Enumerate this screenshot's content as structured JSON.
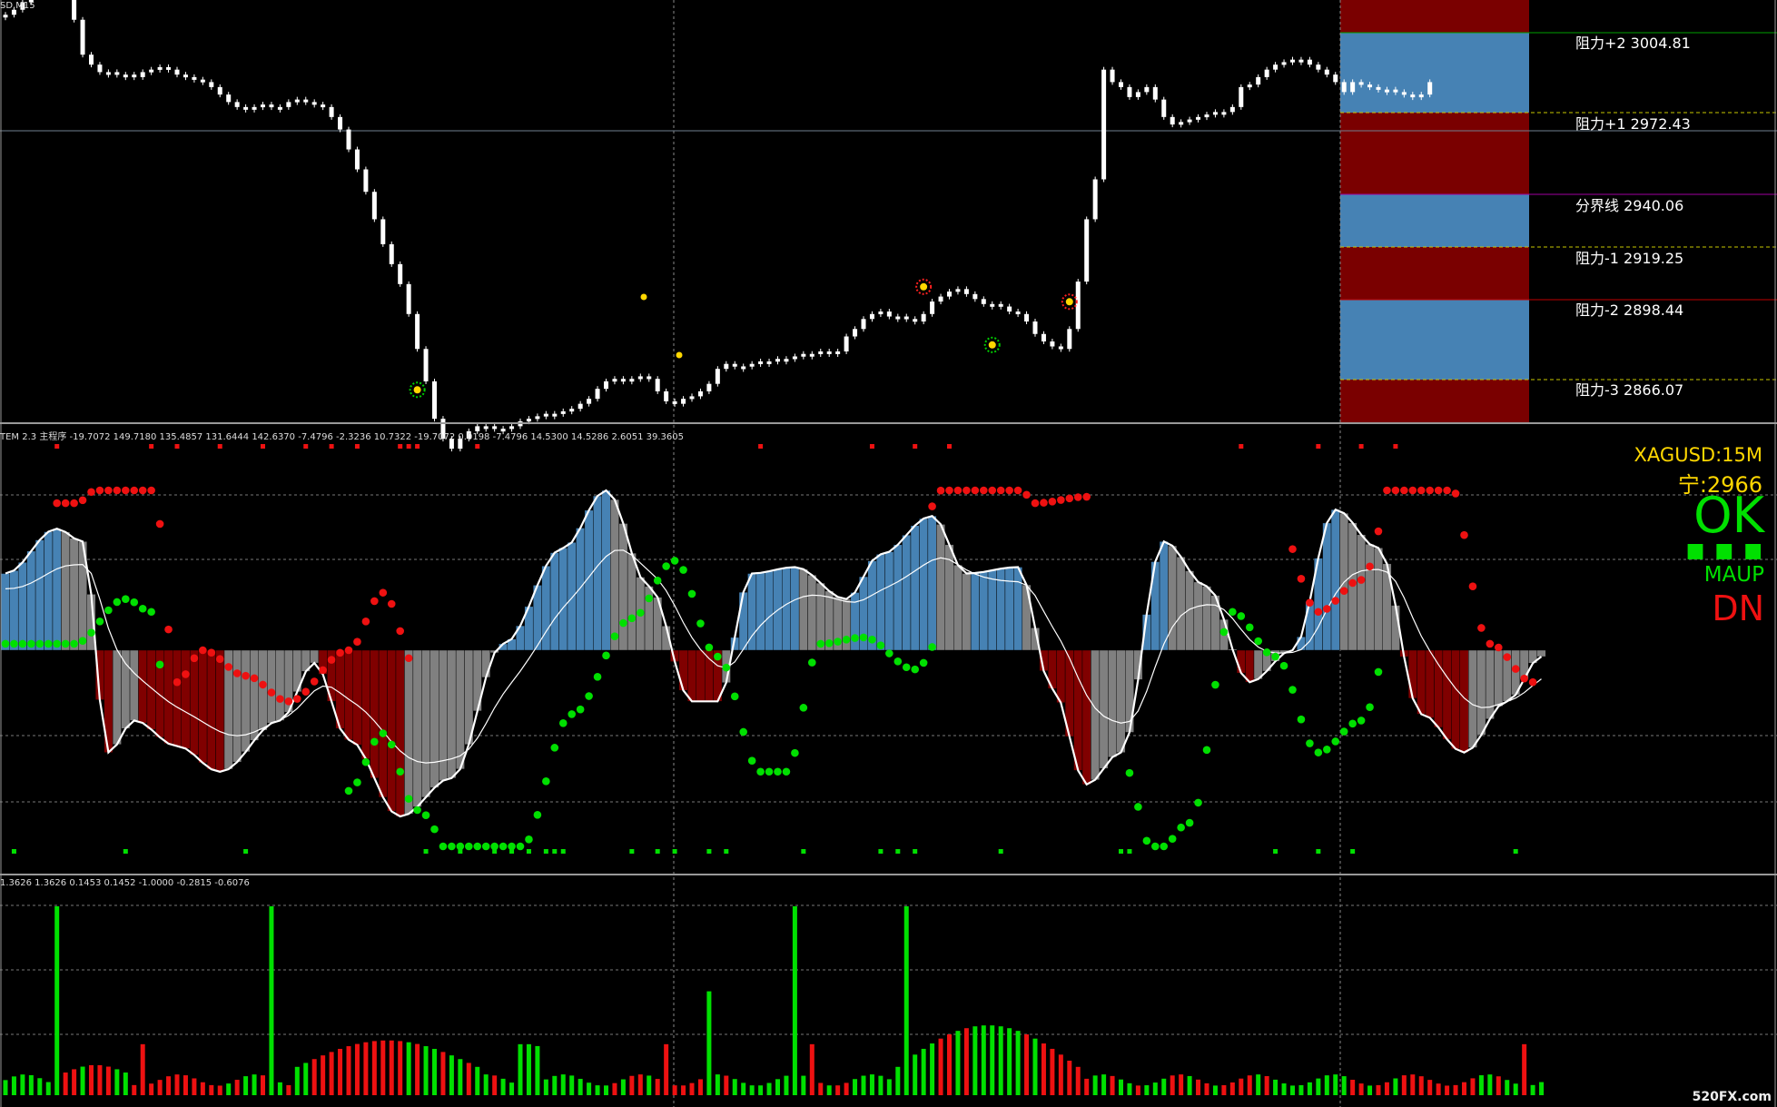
{
  "window": {
    "symbol_label": "SD,M15"
  },
  "colors": {
    "background": "#000000",
    "candle": "#ffffff",
    "zone_red": "#7a0000",
    "zone_blue": "#4682b4",
    "up_green": "#00e000",
    "down_red": "#ee1111",
    "hist_gray": "#808080",
    "hist_blue": "#4682b4",
    "hist_darkred": "#800000",
    "label_yellow": "#ffd700"
  },
  "levels": [
    {
      "label": "阻力+2 3004.81",
      "line_color": "#00a000",
      "style": "solid"
    },
    {
      "label": "阻力+1 2972.43",
      "line_color": "#c8c800",
      "style": "dashed"
    },
    {
      "label": "分界线 2940.06",
      "line_color": "#a000a0",
      "style": "solid"
    },
    {
      "label": "阻力-1 2919.25",
      "line_color": "#c8c800",
      "style": "dashed"
    },
    {
      "label": "阻力-2 2898.44",
      "line_color": "#c00000",
      "style": "solid"
    },
    {
      "label": "阻力-3 2866.07",
      "line_color": "#c8c800",
      "style": "dashed"
    }
  ],
  "zone_bands": [
    "red",
    "blue",
    "red",
    "blue",
    "red",
    "blue",
    "red"
  ],
  "indicator": {
    "header": "TEM 2.3 主程序 -19.7072 149.7180 135.4857 131.6444 142.6370 -7.4796 -2.3236 10.7322 -19.7072 0.0198 -7.4796 14.5300 14.5286 2.6051 39.3605",
    "symbol_tf": "XAGUSD:15M",
    "value_label": "宁:2966",
    "status_ok": "OK",
    "status_squares": "■ ■ ■",
    "ma_label": "MAUP",
    "direction_label": "DN"
  },
  "volume": {
    "header": "1.3626 1.3626 0.1453 0.1452 -1.0000 -0.2815 -0.6076"
  },
  "watermark": "520FX.com",
  "chart_data": [
    {
      "type": "candlestick",
      "title": "",
      "price_levels": [
        3004.81,
        2972.43,
        2940.06,
        2919.25,
        2898.44,
        2866.07
      ],
      "close_series": [
        3012,
        3014,
        3017,
        3020,
        3022,
        3024,
        3025,
        3023,
        3010,
        2996,
        2992,
        2989,
        2989,
        2988,
        2988,
        2987,
        2989,
        2990,
        2991,
        2990,
        2988,
        2987,
        2986,
        2985,
        2983,
        2980,
        2977,
        2975,
        2975,
        2975,
        2976,
        2975,
        2975,
        2977,
        2978,
        2977,
        2976,
        2975,
        2971,
        2966,
        2958,
        2950,
        2941,
        2930,
        2920,
        2912,
        2904,
        2892,
        2878,
        2865,
        2850,
        2842,
        2838,
        2842,
        2845,
        2847,
        2847,
        2846,
        2846,
        2847,
        2849,
        2850,
        2851,
        2852,
        2852,
        2853,
        2854,
        2856,
        2858,
        2862,
        2865,
        2866,
        2865,
        2866,
        2867,
        2866,
        2861,
        2857,
        2856,
        2858,
        2859,
        2861,
        2864,
        2870,
        2872,
        2871,
        2871,
        2872,
        2873,
        2873,
        2874,
        2874,
        2875,
        2876,
        2876,
        2877,
        2876,
        2877,
        2883,
        2886,
        2890,
        2892,
        2893,
        2891,
        2891,
        2890,
        2889,
        2892,
        2897,
        2899,
        2901,
        2902,
        2900,
        2898,
        2896,
        2896,
        2895,
        2893,
        2892,
        2889,
        2884,
        2881,
        2879,
        2878,
        2886,
        2905,
        2930,
        2946,
        2990,
        2985,
        2983,
        2979,
        2981,
        2983,
        2978,
        2971,
        2968,
        2969,
        2970,
        2971,
        2972,
        2973,
        2973,
        2975,
        2983,
        2984,
        2987,
        2990,
        2992,
        2993,
        2994,
        2994,
        2992,
        2990,
        2988,
        2985,
        2981,
        2985,
        2984,
        2983,
        2982,
        2982,
        2981,
        2980,
        2979,
        2980,
        2985
      ],
      "signals": [
        {
          "type": "sell",
          "x_index": 2
        },
        {
          "type": "buy",
          "x_index": 48
        },
        {
          "type": "sell",
          "x_index": 107
        },
        {
          "type": "buy",
          "x_index": 115
        },
        {
          "type": "sell",
          "x_index": 124
        }
      ]
    },
    {
      "type": "oscillator",
      "header_values": [
        -19.7072,
        149.718,
        135.4857,
        131.6444,
        142.637,
        -7.4796,
        -2.3236,
        10.7322,
        -19.7072,
        0.0198,
        -7.4796,
        14.53,
        14.5286,
        2.6051,
        39.3605
      ],
      "ylim": [
        -140,
        140
      ],
      "waypoints": [
        [
          0,
          60
        ],
        [
          6,
          95
        ],
        [
          9,
          85
        ],
        [
          12,
          -80
        ],
        [
          15,
          -55
        ],
        [
          20,
          -75
        ],
        [
          25,
          -95
        ],
        [
          32,
          -55
        ],
        [
          36,
          -10
        ],
        [
          40,
          -70
        ],
        [
          46,
          -130
        ],
        [
          52,
          -100
        ],
        [
          58,
          5
        ],
        [
          65,
          80
        ],
        [
          70,
          125
        ],
        [
          75,
          50
        ],
        [
          80,
          -40
        ],
        [
          83,
          -40
        ],
        [
          87,
          60
        ],
        [
          92,
          65
        ],
        [
          98,
          40
        ],
        [
          102,
          75
        ],
        [
          108,
          105
        ],
        [
          112,
          60
        ],
        [
          118,
          65
        ],
        [
          122,
          -30
        ],
        [
          126,
          -105
        ],
        [
          130,
          -80
        ],
        [
          135,
          85
        ],
        [
          140,
          50
        ],
        [
          145,
          -25
        ],
        [
          150,
          0
        ],
        [
          155,
          110
        ],
        [
          160,
          80
        ],
        [
          165,
          -50
        ],
        [
          170,
          -80
        ],
        [
          175,
          -40
        ],
        [
          179,
          -5
        ]
      ],
      "dots": {
        "green_segments": [
          [
            0,
            18
          ],
          [
            40,
            108
          ],
          [
            131,
            160
          ]
        ],
        "red_segments": [
          [
            6,
            47
          ],
          [
            108,
            126
          ],
          [
            150,
            178
          ]
        ]
      }
    },
    {
      "type": "bar",
      "header_values": [
        1.3626,
        1.3626,
        0.1453,
        0.1452,
        -1.0,
        -0.2815,
        -0.6076
      ],
      "ylim": [
        0,
        1.0
      ]
    }
  ]
}
